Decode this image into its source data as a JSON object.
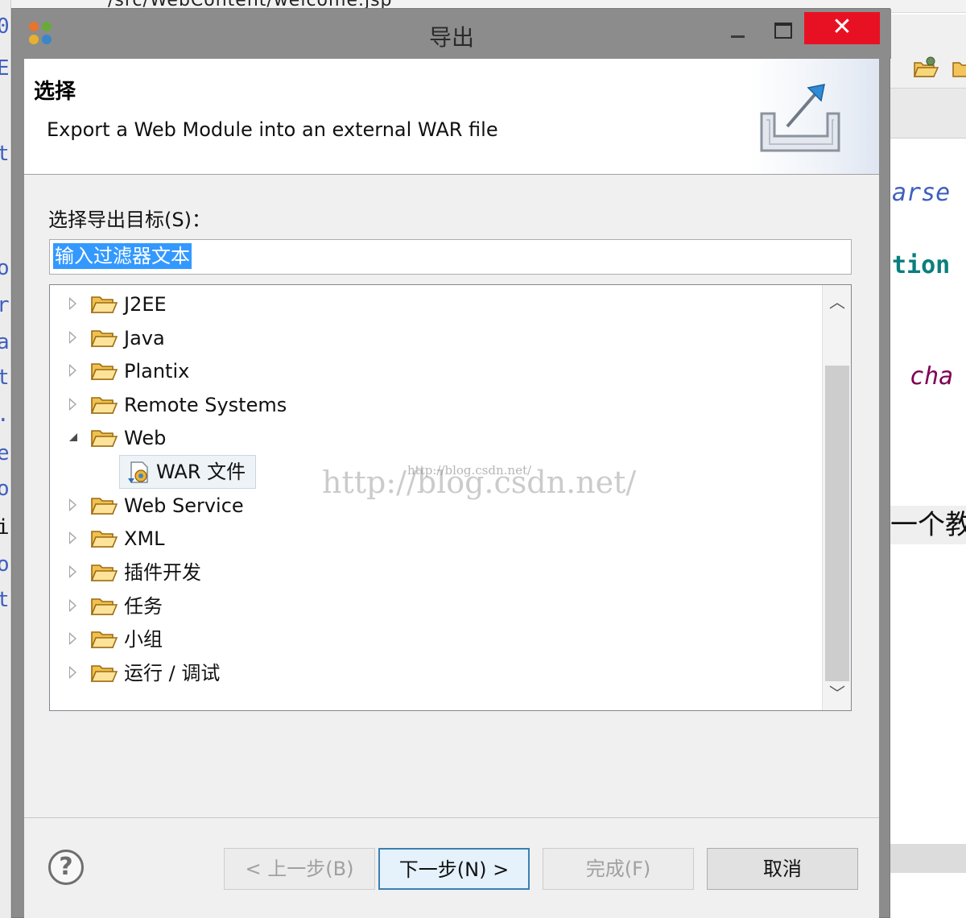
{
  "window": {
    "title": "导出",
    "close_glyph": "✕"
  },
  "banner": {
    "title": "选择",
    "description": "Export a Web Module into an external WAR file"
  },
  "filter": {
    "label": "选择导出目标(S)：",
    "placeholder": "输入过滤器文本"
  },
  "tree": {
    "items": [
      {
        "label": "J2EE",
        "expanded": false
      },
      {
        "label": "Java",
        "expanded": false
      },
      {
        "label": "Plantix",
        "expanded": false
      },
      {
        "label": "Remote Systems",
        "expanded": false
      },
      {
        "label": "Web",
        "expanded": true
      },
      {
        "label": "WAR 文件",
        "child": true,
        "selected": true
      },
      {
        "label": "Web Service",
        "expanded": false
      },
      {
        "label": "XML",
        "expanded": false
      },
      {
        "label": "插件开发",
        "expanded": false
      },
      {
        "label": "任务",
        "expanded": false
      },
      {
        "label": "小组",
        "expanded": false
      },
      {
        "label": "运行 / 调试",
        "expanded": false
      }
    ]
  },
  "watermark": {
    "large": "http://blog.csdn.net/",
    "small": "http://blog.csdn.net/"
  },
  "buttons": {
    "help": "?",
    "back": "< 上一步(B)",
    "next": "下一步(N) >",
    "finish": "完成(F)",
    "cancel": "取消"
  },
  "background": {
    "top_path": "/src/WebContent/welcome.jsp",
    "code_fragments": [
      "arse",
      "tion",
      "cha"
    ],
    "cn_fragment": "一个教"
  },
  "colors": {
    "close_red": "#e81123",
    "selection_blue": "#3399ff",
    "code_blue": "#3f5fbf",
    "code_teal": "#0a7e7e",
    "code_purple": "#7f0055"
  }
}
